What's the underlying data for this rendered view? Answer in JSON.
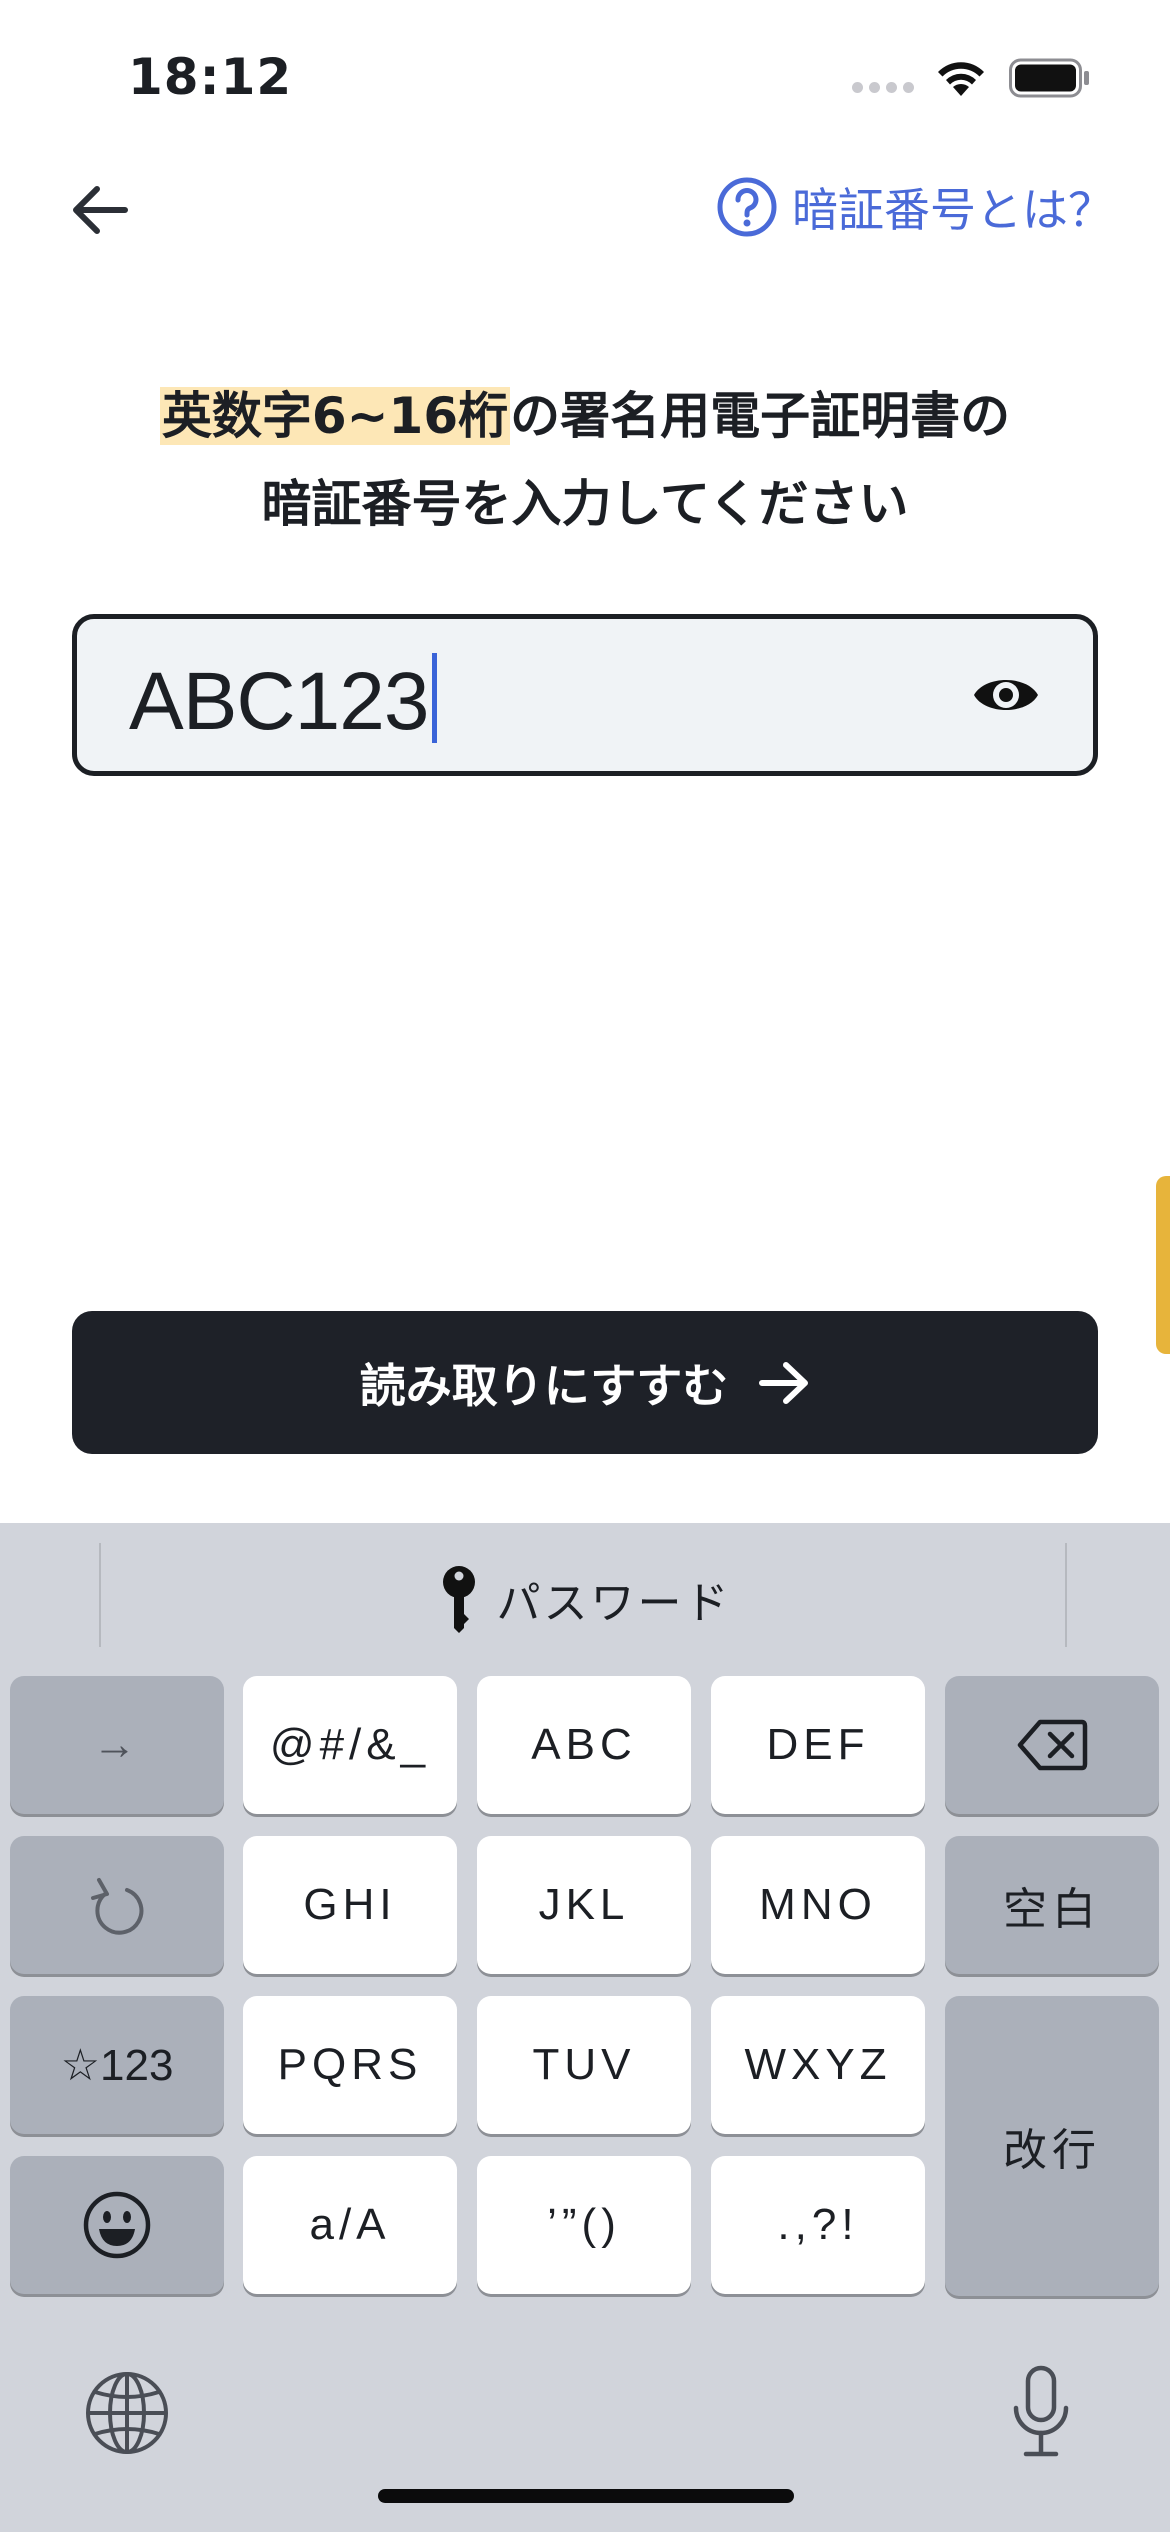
{
  "status_bar": {
    "time": "18:12"
  },
  "header": {
    "help_label": "暗証番号とは？"
  },
  "instruction": {
    "highlight": "英数字6~16桁",
    "line1_rest": "の署名用電子証明書の",
    "line2": "暗証番号を入力してください"
  },
  "pin_input": {
    "value": "ABC123"
  },
  "primary_button": {
    "label": "読み取りにすすむ"
  },
  "keyboard": {
    "suggestion": "パスワード",
    "keys": {
      "next": "→",
      "symbols": "@#/&_",
      "abc": "ABC",
      "def": "DEF",
      "ghi": "GHI",
      "jkl": "JKL",
      "mno": "MNO",
      "space": "空白",
      "mode": "☆123",
      "pqrs": "PQRS",
      "tuv": "TUV",
      "wxyz": "WXYZ",
      "return": "改行",
      "case": "a/A",
      "quotes": "’”()",
      "punct": ".,?!"
    }
  },
  "colors": {
    "accent": "#4a6ad8",
    "highlight": "#fde7b6",
    "button_bg": "#1e2128",
    "field_bg": "#f0f3f6",
    "side_tab": "#e7b43b",
    "keyboard_bg": "#d1d4db"
  }
}
